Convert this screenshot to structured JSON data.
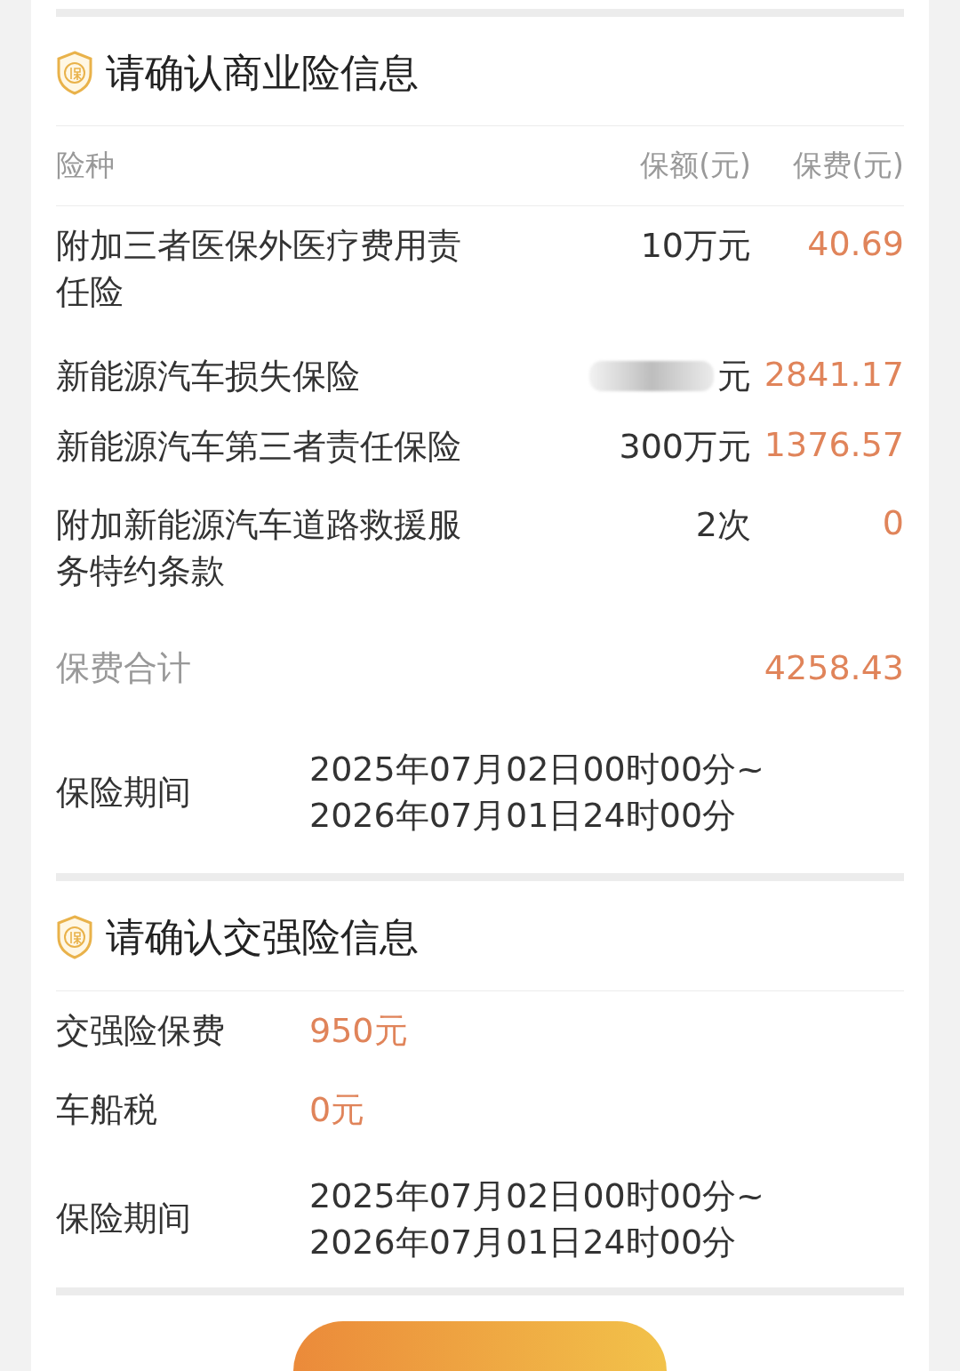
{
  "commercial": {
    "title": "请确认商业险信息",
    "columns": [
      "险种",
      "保额(元)",
      "保费(元)"
    ],
    "rows": [
      {
        "name": "附加三者医保外医疗费用责任险",
        "amount": "10万元",
        "premium": "40.69",
        "redacted": false
      },
      {
        "name": "新能源汽车损失保险",
        "amount": "元",
        "premium": "2841.17",
        "redacted": true
      },
      {
        "name": "新能源汽车第三者责任保险",
        "amount": "300万元",
        "premium": "1376.57",
        "redacted": false
      },
      {
        "name": "附加新能源汽车道路救援服务特约条款",
        "amount": "2次",
        "premium": "0",
        "redacted": false
      }
    ],
    "total": {
      "label": "保费合计",
      "value": "4258.43"
    },
    "period": {
      "label": "保险期间",
      "lines": [
        "2025年07月02日00时00分~",
        "2026年07月01日24时00分"
      ]
    }
  },
  "compulsory": {
    "title": "请确认交强险信息",
    "items": [
      {
        "label": "交强险保费",
        "value": "950元"
      },
      {
        "label": "车船税",
        "value": "0元"
      }
    ],
    "period": {
      "label": "保险期间",
      "lines": [
        "2025年07月02日00时00分~",
        "2026年07月01日24时00分"
      ]
    }
  }
}
